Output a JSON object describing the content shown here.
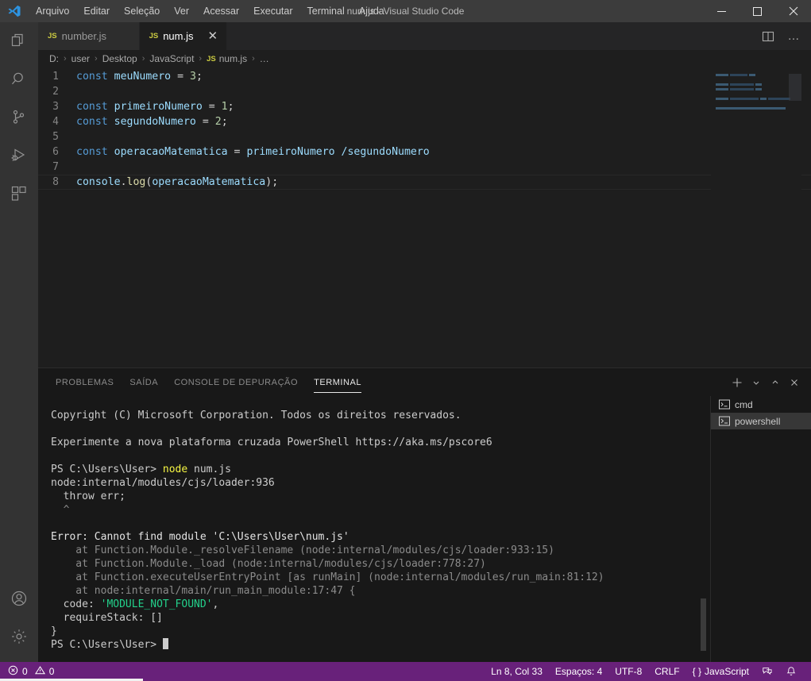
{
  "window": {
    "title": "num.js - Visual Studio Code",
    "minimize_label": "Minimizar",
    "maximize_label": "Maximizar",
    "close_label": "Fechar"
  },
  "menu": {
    "items": [
      {
        "label": "Arquivo"
      },
      {
        "label": "Editar"
      },
      {
        "label": "Seleção"
      },
      {
        "label": "Ver"
      },
      {
        "label": "Acessar"
      },
      {
        "label": "Executar"
      },
      {
        "label": "Terminal"
      },
      {
        "label": "Ajuda"
      }
    ]
  },
  "activitybar": {
    "items": [
      {
        "name": "explorer",
        "icon": "files-icon"
      },
      {
        "name": "search",
        "icon": "search-icon"
      },
      {
        "name": "source-control",
        "icon": "source-control-icon"
      },
      {
        "name": "run-and-debug",
        "icon": "run-debug-icon"
      },
      {
        "name": "extensions",
        "icon": "extensions-icon"
      }
    ],
    "bottom_items": [
      {
        "name": "accounts",
        "icon": "account-icon"
      },
      {
        "name": "manage",
        "icon": "gear-icon"
      }
    ]
  },
  "editor": {
    "tabs": [
      {
        "label": "number.js",
        "badge": "JS",
        "active": false
      },
      {
        "label": "num.js",
        "badge": "JS",
        "active": true
      }
    ],
    "tab_close_glyph": "✕",
    "actions": [
      {
        "name": "split-editor",
        "icon": "split-editor-icon"
      },
      {
        "name": "more-actions",
        "icon": "ellipsis-icon",
        "glyph": "…"
      }
    ],
    "breadcrumb": {
      "items": [
        "D:",
        "user",
        "Desktop",
        "JavaScript",
        "num.js",
        "…"
      ],
      "file_badge": "JS",
      "separator": "›"
    },
    "lines": [
      {
        "number": "1",
        "tokens": [
          {
            "t": "const",
            "c": "kw"
          },
          {
            "t": " ",
            "c": "punc"
          },
          {
            "t": "meuNumero",
            "c": "var"
          },
          {
            "t": " ",
            "c": "punc"
          },
          {
            "t": "=",
            "c": "punc"
          },
          {
            "t": " ",
            "c": "punc"
          },
          {
            "t": "3",
            "c": "num"
          },
          {
            "t": ";",
            "c": "punc"
          }
        ]
      },
      {
        "number": "2",
        "tokens": []
      },
      {
        "number": "3",
        "tokens": [
          {
            "t": "const",
            "c": "kw"
          },
          {
            "t": " ",
            "c": "punc"
          },
          {
            "t": "primeiroNumero",
            "c": "var"
          },
          {
            "t": " ",
            "c": "punc"
          },
          {
            "t": "=",
            "c": "punc"
          },
          {
            "t": " ",
            "c": "punc"
          },
          {
            "t": "1",
            "c": "num"
          },
          {
            "t": ";",
            "c": "punc"
          }
        ]
      },
      {
        "number": "4",
        "tokens": [
          {
            "t": "const",
            "c": "kw"
          },
          {
            "t": " ",
            "c": "punc"
          },
          {
            "t": "segundoNumero",
            "c": "var"
          },
          {
            "t": " ",
            "c": "punc"
          },
          {
            "t": "=",
            "c": "punc"
          },
          {
            "t": " ",
            "c": "punc"
          },
          {
            "t": "2",
            "c": "num"
          },
          {
            "t": ";",
            "c": "punc"
          }
        ]
      },
      {
        "number": "5",
        "tokens": []
      },
      {
        "number": "6",
        "tokens": [
          {
            "t": "const",
            "c": "kw"
          },
          {
            "t": " ",
            "c": "punc"
          },
          {
            "t": "operacaoMatematica",
            "c": "var"
          },
          {
            "t": " ",
            "c": "punc"
          },
          {
            "t": "=",
            "c": "punc"
          },
          {
            "t": " ",
            "c": "punc"
          },
          {
            "t": "primeiroNumero",
            "c": "var"
          },
          {
            "t": " ",
            "c": "punc"
          },
          {
            "t": "/segundoNumero",
            "c": "var"
          }
        ]
      },
      {
        "number": "7",
        "tokens": []
      },
      {
        "number": "8",
        "current": true,
        "tokens": [
          {
            "t": "console",
            "c": "var"
          },
          {
            "t": ".",
            "c": "punc"
          },
          {
            "t": "log",
            "c": "fn"
          },
          {
            "t": "(",
            "c": "punc"
          },
          {
            "t": "operacaoMatematica",
            "c": "var"
          },
          {
            "t": ")",
            "c": "punc"
          },
          {
            "t": ";",
            "c": "punc"
          }
        ]
      }
    ]
  },
  "panel": {
    "tabs": [
      {
        "label": "PROBLEMAS",
        "active": false
      },
      {
        "label": "SAÍDA",
        "active": false
      },
      {
        "label": "CONSOLE DE DEPURAÇÃO",
        "active": false
      },
      {
        "label": "TERMINAL",
        "active": true
      }
    ],
    "actions": [
      {
        "name": "new-terminal",
        "icon": "plus-icon",
        "glyph": "+"
      },
      {
        "name": "terminal-dropdown",
        "icon": "chevron-down-icon",
        "glyph": "⌄"
      },
      {
        "name": "maximize-panel",
        "icon": "chevron-up-icon",
        "glyph": "⌃"
      },
      {
        "name": "close-panel",
        "icon": "close-icon",
        "glyph": "✕"
      }
    ],
    "terminal_tabs": [
      {
        "label": "cmd",
        "icon": "cmd-icon",
        "active": false
      },
      {
        "label": "powershell",
        "icon": "powershell-icon",
        "active": true
      }
    ],
    "terminal_output": {
      "line_copyright": "Copyright (C) Microsoft Corporation. Todos os direitos reservados.",
      "line_blank_1": "",
      "line_experimente": "Experimente a nova plataforma cruzada PowerShell https://aka.ms/pscore6",
      "line_blank_2": "",
      "prompt_1": "PS C:\\Users\\User>",
      "cmd_node": "node",
      "cmd_args": " num.js",
      "line_loader": "node:internal/modules/cjs/loader:936",
      "line_throw": "  throw err;",
      "line_caret": "  ^",
      "line_blank_3": "",
      "line_error": "Error: Cannot find module 'C:\\Users\\User\\num.js'",
      "stack_1": "    at Function.Module._resolveFilename (node:internal/modules/cjs/loader:933:15)",
      "stack_2": "    at Function.Module._load (node:internal/modules/cjs/loader:778:27)",
      "stack_3": "    at Function.executeUserEntryPoint [as runMain] (node:internal/modules/run_main:81:12)",
      "stack_4": "    at node:internal/main/run_main_module:17:47 {",
      "code_key": "  code: ",
      "code_value": "'MODULE_NOT_FOUND'",
      "code_comma": ",",
      "require_stack": "  requireStack: []",
      "brace_close": "}",
      "prompt_2": "PS C:\\Users\\User>"
    }
  },
  "statusbar": {
    "errors": "0",
    "warnings": "0",
    "error_icon": "error-circle-icon",
    "warning_icon": "warning-triangle-icon",
    "right_items": [
      {
        "name": "cursor-position",
        "label": "Ln 8, Col 33"
      },
      {
        "name": "indentation",
        "label": "Espaços: 4"
      },
      {
        "name": "encoding",
        "label": "UTF-8"
      },
      {
        "name": "eol",
        "label": "CRLF"
      },
      {
        "name": "language-mode",
        "label": "JavaScript",
        "prefix": "{ }"
      }
    ],
    "feedback_icon": "feedback-icon",
    "bell_icon": "bell-icon",
    "accent_color": "#68217a"
  },
  "colors": {
    "titlebar": "#3c3c3c",
    "activitybar": "#333333",
    "editor_bg": "#1e1e1e",
    "tab_inactive": "#2d2d2d",
    "panel_bg": "#181818",
    "statusbar": "#68217a",
    "keyword": "#569cd6",
    "variable": "#9cdcfe",
    "number": "#b5cea8",
    "function": "#dcdcaa",
    "js_badge": "#cbcb41",
    "terminal_yellow": "#f5f543",
    "terminal_green": "#23d18b"
  }
}
